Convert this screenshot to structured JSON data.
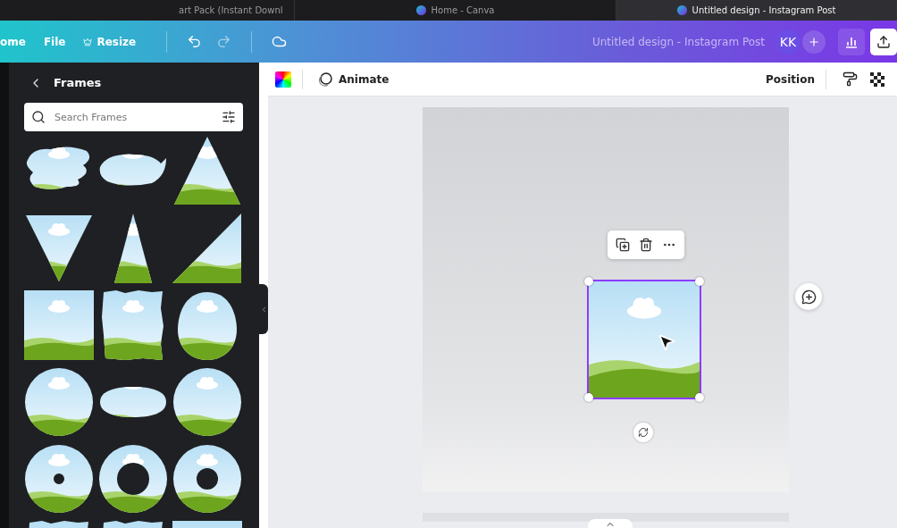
{
  "browser_tabs": [
    {
      "title": "art Pack (Instant Downl",
      "selected": false,
      "kind": "plain"
    },
    {
      "title": "Home - Canva",
      "selected": false,
      "kind": "logo"
    },
    {
      "title": "Untitled design - Instagram Post",
      "selected": true,
      "kind": "logo"
    }
  ],
  "header": {
    "menu": [
      {
        "label": "ome",
        "kind": "text"
      },
      {
        "label": "File",
        "kind": "text"
      },
      {
        "label": "Resize",
        "kind": "crown"
      }
    ],
    "design_title": "Untitled design - Instagram Post",
    "avatar": "KK"
  },
  "panel": {
    "title": "Frames",
    "search": {
      "placeholder": "Search Frames"
    },
    "frames": [
      {
        "kind": "brush"
      },
      {
        "kind": "brush-wave"
      },
      {
        "kind": "triangle"
      },
      {
        "kind": "triangle-down"
      },
      {
        "kind": "triangle-tall"
      },
      {
        "kind": "triangle-right"
      },
      {
        "kind": "square"
      },
      {
        "kind": "torn"
      },
      {
        "kind": "egg"
      },
      {
        "kind": "circle"
      },
      {
        "kind": "ellipse"
      },
      {
        "kind": "circle"
      },
      {
        "kind": "ring-small"
      },
      {
        "kind": "ring-large"
      },
      {
        "kind": "ring-medium"
      },
      {
        "kind": "torn"
      },
      {
        "kind": "torn"
      },
      {
        "kind": "square"
      }
    ]
  },
  "toolbar": {
    "animate": "Animate",
    "position": "Position"
  }
}
